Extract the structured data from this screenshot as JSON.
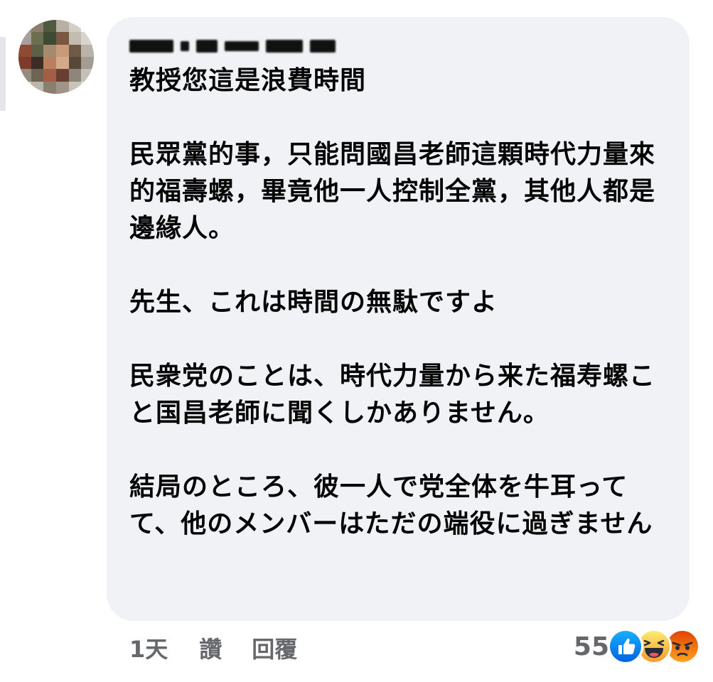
{
  "comment": {
    "author_name": "",
    "paragraphs": [
      "教授您這是浪費時間",
      "民眾黨的事，只能問國昌老師這顆時代力量來的福壽螺，畢竟他一人控制全黨，其他人都是邊緣人。",
      "先生、これは時間の無駄ですよ",
      "民衆党のことは、時代力量から来た福寿螺こと国昌老師に聞くしかありません。",
      "結局のところ、彼一人で党全体を牛耳ってて、他のメンバーはただの端役に過ぎません"
    ]
  },
  "actions": {
    "time": "1天",
    "like_label": "讚",
    "reply_label": "回覆"
  },
  "reactions": {
    "count": "55",
    "icons": [
      "like-icon",
      "haha-icon",
      "angry-icon"
    ],
    "colors": {
      "like": "#1877f2",
      "haha": "#f7b125",
      "angry": "#e9710f"
    }
  },
  "colors": {
    "bubble_bg": "#f0f2f5",
    "text": "#050505",
    "secondary_text": "#65676b"
  }
}
